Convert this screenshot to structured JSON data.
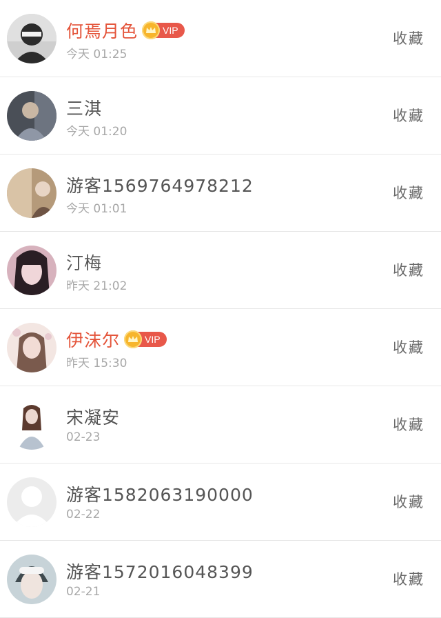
{
  "items": [
    {
      "name": "何焉月色",
      "vip": true,
      "vip_label": "VIP",
      "time": "今天 01:25",
      "action": "收藏",
      "avatar_colors": [
        "#2b2b2b",
        "#cfcfcf",
        "#6c6c6c"
      ]
    },
    {
      "name": "三淇",
      "vip": false,
      "vip_label": "",
      "time": "今天 01:20",
      "action": "收藏",
      "avatar_colors": [
        "#4a4f57",
        "#8f97a6",
        "#c9b7a4"
      ]
    },
    {
      "name": "游客1569764978212",
      "vip": false,
      "vip_label": "",
      "time": "今天 01:01",
      "action": "收藏",
      "avatar_colors": [
        "#b59a7a",
        "#d9c3a6",
        "#e8d5c5"
      ]
    },
    {
      "name": "汀梅",
      "vip": false,
      "vip_label": "",
      "time": "昨天 21:02",
      "action": "收藏",
      "avatar_colors": [
        "#2a1e24",
        "#d7b2bd",
        "#f0d6d9"
      ]
    },
    {
      "name": "伊沫尔",
      "vip": true,
      "vip_label": "VIP",
      "time": "昨天 15:30",
      "action": "收藏",
      "avatar_colors": [
        "#7a5a4d",
        "#d9c2be",
        "#f3e6e2"
      ]
    },
    {
      "name": "宋凝安",
      "vip": false,
      "vip_label": "",
      "time": "02-23",
      "action": "收藏",
      "avatar_colors": [
        "#5c3a2e",
        "#ecd7cf",
        "#b7c2cf"
      ]
    },
    {
      "name": "游客1582063190000",
      "vip": false,
      "vip_label": "",
      "time": "02-22",
      "action": "收藏",
      "avatar_colors": [
        "#ececec",
        "#ffffff",
        "#e2e2e2"
      ]
    },
    {
      "name": "游客1572016048399",
      "vip": false,
      "vip_label": "",
      "time": "02-21",
      "action": "收藏",
      "avatar_colors": [
        "#3f4a4f",
        "#c7d3d8",
        "#efe4de"
      ]
    }
  ]
}
